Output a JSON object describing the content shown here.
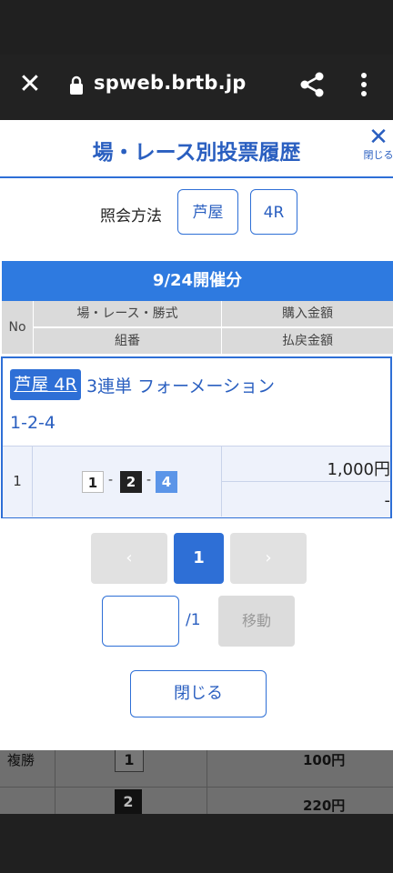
{
  "browser": {
    "url": "spweb.brtb.jp",
    "close_icon": "close-icon",
    "lock_icon": "lock-icon",
    "share_icon": "share-icon",
    "more_icon": "more-vert-icon"
  },
  "modal": {
    "title": "場・レース別投票履歴",
    "close_label": "閉じる",
    "query_label": "照会方法",
    "query_place": "芦屋",
    "query_race": "4R",
    "date_header": "9/24開催分",
    "headers": {
      "no": "No",
      "race_type": "場・レース・勝式",
      "purchase": "購入金額",
      "combination": "組番",
      "refund": "払戻金額"
    },
    "entry": {
      "place_race": "芦屋 4R",
      "bet_type": "3連単 フォーメーション",
      "combination": "1-2-4",
      "row_no": "1",
      "numbers": [
        "1",
        "2",
        "4"
      ],
      "purchase_amount": "1,000円",
      "refund_amount": "-"
    },
    "pagination": {
      "prev": "‹",
      "current": "1",
      "next": "›",
      "total": "/1",
      "move": "移動"
    },
    "close_button": "閉じる"
  },
  "background": {
    "label": "複勝",
    "num1": "1",
    "num2": "2",
    "amount1": "100円",
    "amount2": "220円"
  },
  "colors": {
    "accent": "#2e6fd6",
    "header_blue": "#2e7ae0",
    "num2_box": "#222222",
    "num4_box": "#5b95e8"
  }
}
